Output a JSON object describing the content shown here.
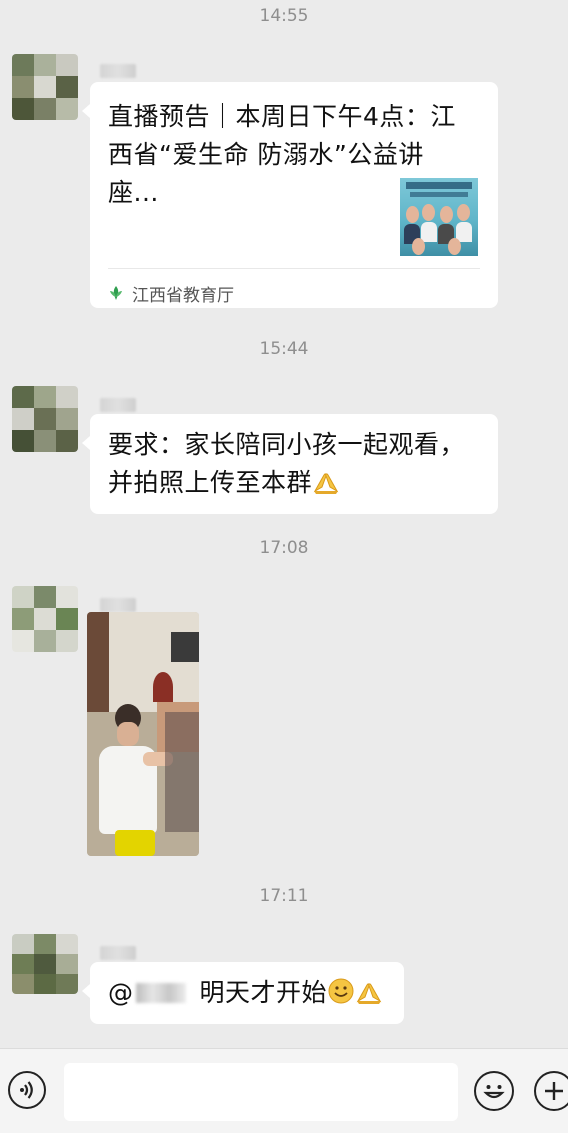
{
  "colors": {
    "background": "#ebebeb",
    "bubble": "#ffffff",
    "timestamp_text": "#8e8e8e",
    "source_icon_green": "#2e9e4e"
  },
  "messages": [
    {
      "time": "14:55",
      "type": "link-card",
      "title": "直播预告｜本周日下午4点：江西省“爱生命 防溺水”公益讲座...",
      "thumbnail_text": "爱生命 防溺水",
      "source": "江西省教育厅",
      "source_icon": "leaf-logo-icon"
    },
    {
      "time": "15:44",
      "type": "text",
      "text": "要求：家长陪同小孩一起观看，并拍照上传至本群",
      "trailing_emoji": "folded-hands-icon"
    },
    {
      "time": "17:08",
      "type": "image",
      "image_subject": "photo of a child watching TV"
    },
    {
      "time": "17:11",
      "type": "text",
      "mention_prefix": "@",
      "text": "明天才开始",
      "trailing_emojis": [
        "smile-face-icon",
        "folded-hands-icon"
      ]
    }
  ],
  "input_bar": {
    "voice_icon": "voice-icon",
    "emoji_icon": "emoji-face-icon",
    "plus_icon": "plus-icon",
    "input_value": ""
  }
}
